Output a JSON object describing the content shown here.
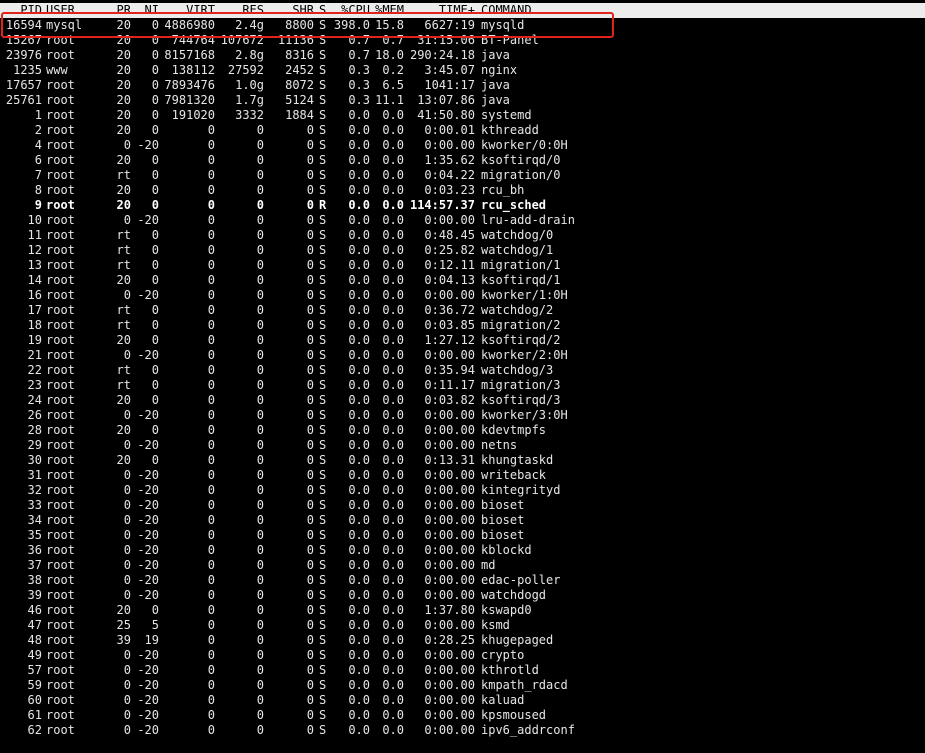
{
  "header": {
    "pid": "PID",
    "user": "USER",
    "pr": "PR",
    "ni": "NI",
    "virt": "VIRT",
    "res": "RES",
    "shr": "SHR",
    "s": "S",
    "cpu": "%CPU",
    "mem": "%MEM",
    "time": "TIME+",
    "command": "COMMAND"
  },
  "colors": {
    "background": "#000000",
    "text": "#e6e6e6",
    "header_bg": "#ececec",
    "highlight_border": "#e0241c"
  },
  "processes": [
    {
      "pid": "16594",
      "user": "mysql",
      "pr": "20",
      "ni": "0",
      "virt": "4886980",
      "res": "2.4g",
      "shr": "8800",
      "s": "S",
      "cpu": "398.0",
      "mem": "15.8",
      "time": "6627:19",
      "command": "mysqld"
    },
    {
      "pid": "15267",
      "user": "root",
      "pr": "20",
      "ni": "0",
      "virt": "744764",
      "res": "107672",
      "shr": "11136",
      "s": "S",
      "cpu": "0.7",
      "mem": "0.7",
      "time": "31:15.06",
      "command": "BT-Panel"
    },
    {
      "pid": "23976",
      "user": "root",
      "pr": "20",
      "ni": "0",
      "virt": "8157168",
      "res": "2.8g",
      "shr": "8316",
      "s": "S",
      "cpu": "0.7",
      "mem": "18.0",
      "time": "290:24.18",
      "command": "java"
    },
    {
      "pid": "1235",
      "user": "www",
      "pr": "20",
      "ni": "0",
      "virt": "138112",
      "res": "27592",
      "shr": "2452",
      "s": "S",
      "cpu": "0.3",
      "mem": "0.2",
      "time": "3:45.07",
      "command": "nginx"
    },
    {
      "pid": "17657",
      "user": "root",
      "pr": "20",
      "ni": "0",
      "virt": "7893476",
      "res": "1.0g",
      "shr": "8072",
      "s": "S",
      "cpu": "0.3",
      "mem": "6.5",
      "time": "1041:17",
      "command": "java"
    },
    {
      "pid": "25761",
      "user": "root",
      "pr": "20",
      "ni": "0",
      "virt": "7981320",
      "res": "1.7g",
      "shr": "5124",
      "s": "S",
      "cpu": "0.3",
      "mem": "11.1",
      "time": "13:07.86",
      "command": "java"
    },
    {
      "pid": "1",
      "user": "root",
      "pr": "20",
      "ni": "0",
      "virt": "191020",
      "res": "3332",
      "shr": "1884",
      "s": "S",
      "cpu": "0.0",
      "mem": "0.0",
      "time": "41:50.80",
      "command": "systemd"
    },
    {
      "pid": "2",
      "user": "root",
      "pr": "20",
      "ni": "0",
      "virt": "0",
      "res": "0",
      "shr": "0",
      "s": "S",
      "cpu": "0.0",
      "mem": "0.0",
      "time": "0:00.01",
      "command": "kthreadd"
    },
    {
      "pid": "4",
      "user": "root",
      "pr": "0",
      "ni": "-20",
      "virt": "0",
      "res": "0",
      "shr": "0",
      "s": "S",
      "cpu": "0.0",
      "mem": "0.0",
      "time": "0:00.00",
      "command": "kworker/0:0H"
    },
    {
      "pid": "6",
      "user": "root",
      "pr": "20",
      "ni": "0",
      "virt": "0",
      "res": "0",
      "shr": "0",
      "s": "S",
      "cpu": "0.0",
      "mem": "0.0",
      "time": "1:35.62",
      "command": "ksoftirqd/0"
    },
    {
      "pid": "7",
      "user": "root",
      "pr": "rt",
      "ni": "0",
      "virt": "0",
      "res": "0",
      "shr": "0",
      "s": "S",
      "cpu": "0.0",
      "mem": "0.0",
      "time": "0:04.22",
      "command": "migration/0"
    },
    {
      "pid": "8",
      "user": "root",
      "pr": "20",
      "ni": "0",
      "virt": "0",
      "res": "0",
      "shr": "0",
      "s": "S",
      "cpu": "0.0",
      "mem": "0.0",
      "time": "0:03.23",
      "command": "rcu_bh"
    },
    {
      "pid": "9",
      "user": "root",
      "pr": "20",
      "ni": "0",
      "virt": "0",
      "res": "0",
      "shr": "0",
      "s": "R",
      "cpu": "0.0",
      "mem": "0.0",
      "time": "114:57.37",
      "command": "rcu_sched",
      "active": true
    },
    {
      "pid": "10",
      "user": "root",
      "pr": "0",
      "ni": "-20",
      "virt": "0",
      "res": "0",
      "shr": "0",
      "s": "S",
      "cpu": "0.0",
      "mem": "0.0",
      "time": "0:00.00",
      "command": "lru-add-drain"
    },
    {
      "pid": "11",
      "user": "root",
      "pr": "rt",
      "ni": "0",
      "virt": "0",
      "res": "0",
      "shr": "0",
      "s": "S",
      "cpu": "0.0",
      "mem": "0.0",
      "time": "0:48.45",
      "command": "watchdog/0"
    },
    {
      "pid": "12",
      "user": "root",
      "pr": "rt",
      "ni": "0",
      "virt": "0",
      "res": "0",
      "shr": "0",
      "s": "S",
      "cpu": "0.0",
      "mem": "0.0",
      "time": "0:25.82",
      "command": "watchdog/1"
    },
    {
      "pid": "13",
      "user": "root",
      "pr": "rt",
      "ni": "0",
      "virt": "0",
      "res": "0",
      "shr": "0",
      "s": "S",
      "cpu": "0.0",
      "mem": "0.0",
      "time": "0:12.11",
      "command": "migration/1"
    },
    {
      "pid": "14",
      "user": "root",
      "pr": "20",
      "ni": "0",
      "virt": "0",
      "res": "0",
      "shr": "0",
      "s": "S",
      "cpu": "0.0",
      "mem": "0.0",
      "time": "0:04.13",
      "command": "ksoftirqd/1"
    },
    {
      "pid": "16",
      "user": "root",
      "pr": "0",
      "ni": "-20",
      "virt": "0",
      "res": "0",
      "shr": "0",
      "s": "S",
      "cpu": "0.0",
      "mem": "0.0",
      "time": "0:00.00",
      "command": "kworker/1:0H"
    },
    {
      "pid": "17",
      "user": "root",
      "pr": "rt",
      "ni": "0",
      "virt": "0",
      "res": "0",
      "shr": "0",
      "s": "S",
      "cpu": "0.0",
      "mem": "0.0",
      "time": "0:36.72",
      "command": "watchdog/2"
    },
    {
      "pid": "18",
      "user": "root",
      "pr": "rt",
      "ni": "0",
      "virt": "0",
      "res": "0",
      "shr": "0",
      "s": "S",
      "cpu": "0.0",
      "mem": "0.0",
      "time": "0:03.85",
      "command": "migration/2"
    },
    {
      "pid": "19",
      "user": "root",
      "pr": "20",
      "ni": "0",
      "virt": "0",
      "res": "0",
      "shr": "0",
      "s": "S",
      "cpu": "0.0",
      "mem": "0.0",
      "time": "1:27.12",
      "command": "ksoftirqd/2"
    },
    {
      "pid": "21",
      "user": "root",
      "pr": "0",
      "ni": "-20",
      "virt": "0",
      "res": "0",
      "shr": "0",
      "s": "S",
      "cpu": "0.0",
      "mem": "0.0",
      "time": "0:00.00",
      "command": "kworker/2:0H"
    },
    {
      "pid": "22",
      "user": "root",
      "pr": "rt",
      "ni": "0",
      "virt": "0",
      "res": "0",
      "shr": "0",
      "s": "S",
      "cpu": "0.0",
      "mem": "0.0",
      "time": "0:35.94",
      "command": "watchdog/3"
    },
    {
      "pid": "23",
      "user": "root",
      "pr": "rt",
      "ni": "0",
      "virt": "0",
      "res": "0",
      "shr": "0",
      "s": "S",
      "cpu": "0.0",
      "mem": "0.0",
      "time": "0:11.17",
      "command": "migration/3"
    },
    {
      "pid": "24",
      "user": "root",
      "pr": "20",
      "ni": "0",
      "virt": "0",
      "res": "0",
      "shr": "0",
      "s": "S",
      "cpu": "0.0",
      "mem": "0.0",
      "time": "0:03.82",
      "command": "ksoftirqd/3"
    },
    {
      "pid": "26",
      "user": "root",
      "pr": "0",
      "ni": "-20",
      "virt": "0",
      "res": "0",
      "shr": "0",
      "s": "S",
      "cpu": "0.0",
      "mem": "0.0",
      "time": "0:00.00",
      "command": "kworker/3:0H"
    },
    {
      "pid": "28",
      "user": "root",
      "pr": "20",
      "ni": "0",
      "virt": "0",
      "res": "0",
      "shr": "0",
      "s": "S",
      "cpu": "0.0",
      "mem": "0.0",
      "time": "0:00.00",
      "command": "kdevtmpfs"
    },
    {
      "pid": "29",
      "user": "root",
      "pr": "0",
      "ni": "-20",
      "virt": "0",
      "res": "0",
      "shr": "0",
      "s": "S",
      "cpu": "0.0",
      "mem": "0.0",
      "time": "0:00.00",
      "command": "netns"
    },
    {
      "pid": "30",
      "user": "root",
      "pr": "20",
      "ni": "0",
      "virt": "0",
      "res": "0",
      "shr": "0",
      "s": "S",
      "cpu": "0.0",
      "mem": "0.0",
      "time": "0:13.31",
      "command": "khungtaskd"
    },
    {
      "pid": "31",
      "user": "root",
      "pr": "0",
      "ni": "-20",
      "virt": "0",
      "res": "0",
      "shr": "0",
      "s": "S",
      "cpu": "0.0",
      "mem": "0.0",
      "time": "0:00.00",
      "command": "writeback"
    },
    {
      "pid": "32",
      "user": "root",
      "pr": "0",
      "ni": "-20",
      "virt": "0",
      "res": "0",
      "shr": "0",
      "s": "S",
      "cpu": "0.0",
      "mem": "0.0",
      "time": "0:00.00",
      "command": "kintegrityd"
    },
    {
      "pid": "33",
      "user": "root",
      "pr": "0",
      "ni": "-20",
      "virt": "0",
      "res": "0",
      "shr": "0",
      "s": "S",
      "cpu": "0.0",
      "mem": "0.0",
      "time": "0:00.00",
      "command": "bioset"
    },
    {
      "pid": "34",
      "user": "root",
      "pr": "0",
      "ni": "-20",
      "virt": "0",
      "res": "0",
      "shr": "0",
      "s": "S",
      "cpu": "0.0",
      "mem": "0.0",
      "time": "0:00.00",
      "command": "bioset"
    },
    {
      "pid": "35",
      "user": "root",
      "pr": "0",
      "ni": "-20",
      "virt": "0",
      "res": "0",
      "shr": "0",
      "s": "S",
      "cpu": "0.0",
      "mem": "0.0",
      "time": "0:00.00",
      "command": "bioset"
    },
    {
      "pid": "36",
      "user": "root",
      "pr": "0",
      "ni": "-20",
      "virt": "0",
      "res": "0",
      "shr": "0",
      "s": "S",
      "cpu": "0.0",
      "mem": "0.0",
      "time": "0:00.00",
      "command": "kblockd"
    },
    {
      "pid": "37",
      "user": "root",
      "pr": "0",
      "ni": "-20",
      "virt": "0",
      "res": "0",
      "shr": "0",
      "s": "S",
      "cpu": "0.0",
      "mem": "0.0",
      "time": "0:00.00",
      "command": "md"
    },
    {
      "pid": "38",
      "user": "root",
      "pr": "0",
      "ni": "-20",
      "virt": "0",
      "res": "0",
      "shr": "0",
      "s": "S",
      "cpu": "0.0",
      "mem": "0.0",
      "time": "0:00.00",
      "command": "edac-poller"
    },
    {
      "pid": "39",
      "user": "root",
      "pr": "0",
      "ni": "-20",
      "virt": "0",
      "res": "0",
      "shr": "0",
      "s": "S",
      "cpu": "0.0",
      "mem": "0.0",
      "time": "0:00.00",
      "command": "watchdogd"
    },
    {
      "pid": "46",
      "user": "root",
      "pr": "20",
      "ni": "0",
      "virt": "0",
      "res": "0",
      "shr": "0",
      "s": "S",
      "cpu": "0.0",
      "mem": "0.0",
      "time": "1:37.80",
      "command": "kswapd0"
    },
    {
      "pid": "47",
      "user": "root",
      "pr": "25",
      "ni": "5",
      "virt": "0",
      "res": "0",
      "shr": "0",
      "s": "S",
      "cpu": "0.0",
      "mem": "0.0",
      "time": "0:00.00",
      "command": "ksmd"
    },
    {
      "pid": "48",
      "user": "root",
      "pr": "39",
      "ni": "19",
      "virt": "0",
      "res": "0",
      "shr": "0",
      "s": "S",
      "cpu": "0.0",
      "mem": "0.0",
      "time": "0:28.25",
      "command": "khugepaged"
    },
    {
      "pid": "49",
      "user": "root",
      "pr": "0",
      "ni": "-20",
      "virt": "0",
      "res": "0",
      "shr": "0",
      "s": "S",
      "cpu": "0.0",
      "mem": "0.0",
      "time": "0:00.00",
      "command": "crypto"
    },
    {
      "pid": "57",
      "user": "root",
      "pr": "0",
      "ni": "-20",
      "virt": "0",
      "res": "0",
      "shr": "0",
      "s": "S",
      "cpu": "0.0",
      "mem": "0.0",
      "time": "0:00.00",
      "command": "kthrotld"
    },
    {
      "pid": "59",
      "user": "root",
      "pr": "0",
      "ni": "-20",
      "virt": "0",
      "res": "0",
      "shr": "0",
      "s": "S",
      "cpu": "0.0",
      "mem": "0.0",
      "time": "0:00.00",
      "command": "kmpath_rdacd"
    },
    {
      "pid": "60",
      "user": "root",
      "pr": "0",
      "ni": "-20",
      "virt": "0",
      "res": "0",
      "shr": "0",
      "s": "S",
      "cpu": "0.0",
      "mem": "0.0",
      "time": "0:00.00",
      "command": "kaluad"
    },
    {
      "pid": "61",
      "user": "root",
      "pr": "0",
      "ni": "-20",
      "virt": "0",
      "res": "0",
      "shr": "0",
      "s": "S",
      "cpu": "0.0",
      "mem": "0.0",
      "time": "0:00.00",
      "command": "kpsmoused"
    },
    {
      "pid": "62",
      "user": "root",
      "pr": "0",
      "ni": "-20",
      "virt": "0",
      "res": "0",
      "shr": "0",
      "s": "S",
      "cpu": "0.0",
      "mem": "0.0",
      "time": "0:00.00",
      "command": "ipv6_addrconf"
    }
  ]
}
